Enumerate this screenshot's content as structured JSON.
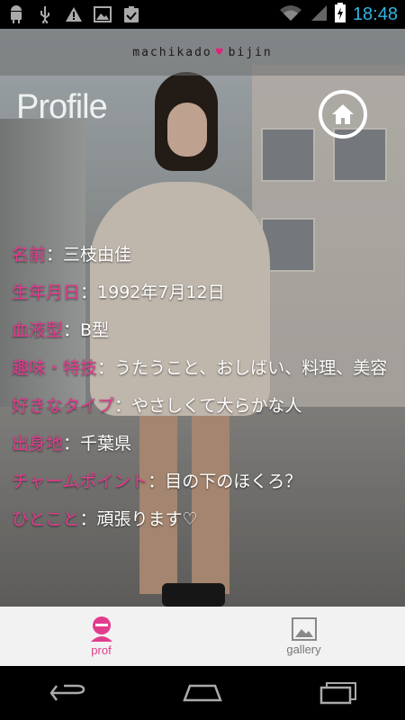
{
  "status_bar": {
    "time": "18:48",
    "left_icons": [
      "android-icon",
      "usb-icon",
      "warning-icon",
      "image-icon",
      "clipboard-check-icon"
    ],
    "right_icons": [
      "wifi-icon",
      "signal-icon",
      "battery-charging-icon"
    ],
    "accent_color": "#33b5e5"
  },
  "header": {
    "brand_left": "machikado",
    "brand_right": "bijin",
    "brand_heart_color": "#e0207a",
    "title": "Profile",
    "home_icon": "home-icon"
  },
  "profile": {
    "key_color": "#e23c8f",
    "rows": [
      {
        "key": "名前",
        "value": "三枝由佳"
      },
      {
        "key": "生年月日",
        "value": "1992年7月12日"
      },
      {
        "key": "血液型",
        "value": "B型"
      },
      {
        "key": "趣味・特技",
        "value": "うたうこと、おしばい、料理、美容"
      },
      {
        "key": "好きなタイプ",
        "value": "やさしくて大らかな人"
      },
      {
        "key": "出身地",
        "value": "千葉県"
      },
      {
        "key": "チャームポイント",
        "value": "目の下のほくろ？"
      },
      {
        "key": "ひとこと",
        "value": "頑張ります♡"
      }
    ]
  },
  "tabs": [
    {
      "label": "prof",
      "icon": "person-icon",
      "active": true
    },
    {
      "label": "gallery",
      "icon": "gallery-icon",
      "active": false
    }
  ],
  "nav_bar": {
    "icons": [
      "back-icon",
      "home-nav-icon",
      "recent-apps-icon"
    ]
  }
}
